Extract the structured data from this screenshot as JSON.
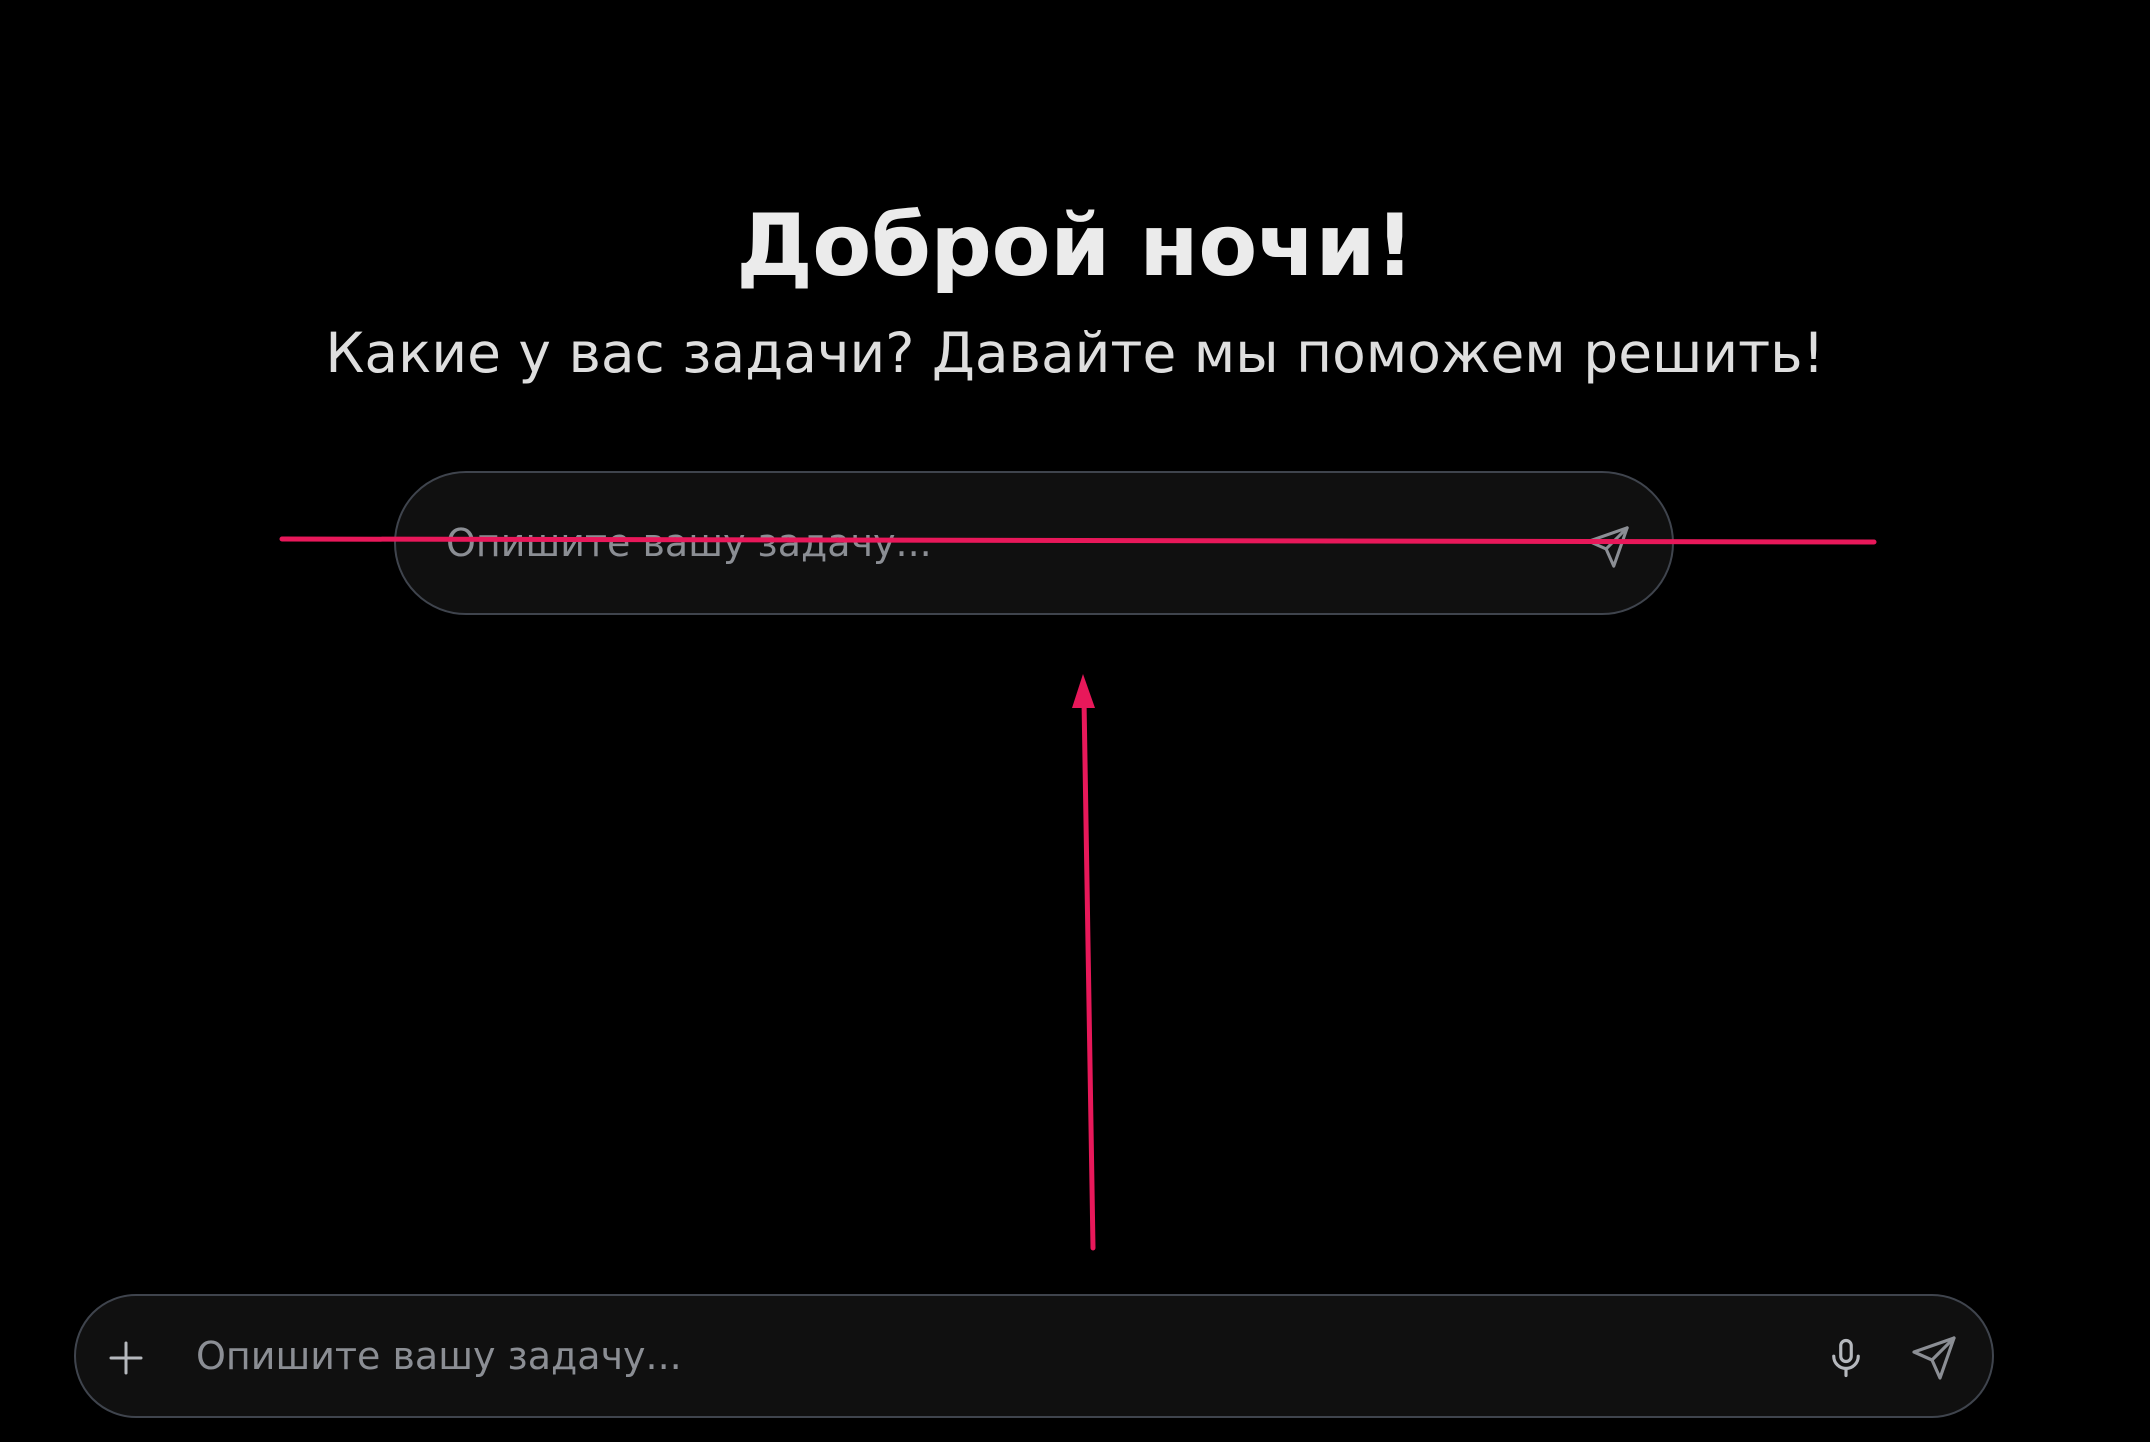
{
  "greeting": {
    "title": "Доброй ночи!",
    "subtitle": "Какие у вас задачи? Давайте мы поможем решить!"
  },
  "hero_input": {
    "placeholder": "Опишите вашу задачу...",
    "value": "",
    "send_icon": "send-icon"
  },
  "bottom_bar": {
    "placeholder": "Опишите вашу задачу...",
    "value": "",
    "attach_icon": "plus-icon",
    "mic_icon": "microphone-icon",
    "send_icon": "send-icon"
  },
  "colors": {
    "background": "#000000",
    "input_background": "#101010",
    "input_border": "#3f444d",
    "placeholder": "#8b8e94",
    "annotation": "#e8185a"
  }
}
